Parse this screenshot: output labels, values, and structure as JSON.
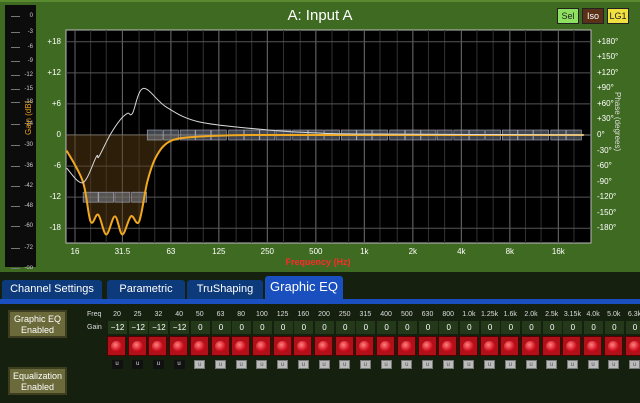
{
  "header": {
    "title": "A: Input A",
    "buttons": [
      {
        "label": "Sel",
        "color": "#8ee060"
      },
      {
        "label": "Iso",
        "color": "#5a3018"
      },
      {
        "label": "LG1",
        "color": "#f0e040"
      }
    ]
  },
  "meter": {
    "ticks": [
      "0",
      "-3",
      "-6",
      "-9",
      "-12",
      "-15",
      "-18",
      "-24",
      "-30",
      "-36",
      "-42",
      "-48",
      "-60",
      "-72",
      "-oo"
    ]
  },
  "chart_data": {
    "type": "line",
    "xlabel": "Frequency (Hz)",
    "ylabel": "Gain (dB)",
    "y2label": "Phase (degrees)",
    "xscale": "log",
    "xlim": [
      14,
      23000
    ],
    "ylim": [
      -20,
      20
    ],
    "y2lim": [
      -200,
      200
    ],
    "xticks": [
      "16",
      "31.5",
      "63",
      "125",
      "250",
      "500",
      "1k",
      "2k",
      "4k",
      "8k",
      "16k"
    ],
    "xtick_values": [
      16,
      31.5,
      63,
      125,
      250,
      500,
      1000,
      2000,
      4000,
      8000,
      16000
    ],
    "yticks": [
      "+18",
      "+12",
      "+6",
      "0",
      "-6",
      "-12",
      "-18"
    ],
    "ytick_values": [
      18,
      12,
      6,
      0,
      -6,
      -12,
      -18
    ],
    "y2ticks": [
      "+180°",
      "+150°",
      "+120°",
      "+90°",
      "+60°",
      "+30°",
      "0°",
      "-30°",
      "-60°",
      "-90°",
      "-120°",
      "-150°",
      "-180°"
    ],
    "y2tick_values": [
      180,
      150,
      120,
      90,
      60,
      30,
      0,
      -30,
      -60,
      -90,
      -120,
      -150,
      -180
    ],
    "series": [
      {
        "name": "Gain",
        "color": "#f0a820",
        "x": [
          14.2,
          17.9,
          20,
          22.3,
          25,
          28.3,
          31.5,
          35.6,
          40,
          45,
          51,
          61.5,
          86,
          195,
          1000,
          23000
        ],
        "y": [
          -3,
          -9,
          -16.7,
          -15.4,
          -19.2,
          -15.7,
          -19.2,
          -15.7,
          -16.7,
          -9,
          -4.2,
          -1.3,
          -0.4,
          0,
          0,
          0
        ]
      },
      {
        "name": "Phase",
        "color": "#d8d8d8",
        "axis": "y2",
        "x": [
          14.2,
          17.9,
          21.7,
          22.5,
          26.4,
          30.5,
          34,
          36.4,
          42.5,
          59,
          95,
          248,
          505,
          1000,
          23000
        ],
        "y": [
          -64,
          -92,
          -42,
          -42,
          0,
          29,
          42,
          42,
          90,
          54,
          25,
          10,
          4,
          2,
          0
        ]
      }
    ],
    "band_markers": {
      "freqs": [
        20,
        25,
        31.5,
        40,
        50,
        63,
        80,
        100,
        125,
        160,
        200,
        250,
        315,
        400,
        500,
        630,
        800,
        1000,
        1250,
        1600,
        2000,
        2500,
        3150,
        4000,
        5000,
        6300,
        8000,
        10000,
        12500,
        16000,
        20000
      ],
      "gains": [
        -12,
        -12,
        -12,
        -12,
        0,
        0,
        0,
        0,
        0,
        0,
        0,
        0,
        0,
        0,
        0,
        0,
        0,
        0,
        0,
        0,
        0,
        0,
        0,
        0,
        0,
        0,
        0,
        0,
        0,
        0,
        0
      ]
    }
  },
  "tabs": [
    {
      "label": "Channel Settings"
    },
    {
      "label": "Parametric"
    },
    {
      "label": "TruShaping"
    },
    {
      "label": "Graphic EQ",
      "active": true
    }
  ],
  "eq": {
    "graphic_eq_button": "Graphic EQ Enabled",
    "equalization_button": "Equalization Enabled",
    "freq_label": "Freq",
    "gain_label": "Gain",
    "bands": [
      {
        "f": "20",
        "g": "−12",
        "u": "u",
        "uActive": true
      },
      {
        "f": "25",
        "g": "−12",
        "u": "u",
        "uActive": true
      },
      {
        "f": "32",
        "g": "−12",
        "u": "u",
        "uActive": true
      },
      {
        "f": "40",
        "g": "−12",
        "u": "u",
        "uActive": true
      },
      {
        "f": "50",
        "g": "0",
        "u": "u"
      },
      {
        "f": "63",
        "g": "0",
        "u": "u"
      },
      {
        "f": "80",
        "g": "0",
        "u": "u"
      },
      {
        "f": "100",
        "g": "0",
        "u": "u"
      },
      {
        "f": "125",
        "g": "0",
        "u": "u"
      },
      {
        "f": "160",
        "g": "0",
        "u": "u"
      },
      {
        "f": "200",
        "g": "0",
        "u": "u"
      },
      {
        "f": "250",
        "g": "0",
        "u": "u"
      },
      {
        "f": "315",
        "g": "0",
        "u": "u"
      },
      {
        "f": "400",
        "g": "0",
        "u": "u"
      },
      {
        "f": "500",
        "g": "0",
        "u": "u"
      },
      {
        "f": "630",
        "g": "0",
        "u": "u"
      },
      {
        "f": "800",
        "g": "0",
        "u": "u"
      },
      {
        "f": "1.0k",
        "g": "0",
        "u": "u"
      },
      {
        "f": "1.25k",
        "g": "0",
        "u": "u"
      },
      {
        "f": "1.6k",
        "g": "0",
        "u": "u"
      },
      {
        "f": "2.0k",
        "g": "0",
        "u": "u"
      },
      {
        "f": "2.5k",
        "g": "0",
        "u": "u"
      },
      {
        "f": "3.15k",
        "g": "0",
        "u": "u"
      },
      {
        "f": "4.0k",
        "g": "0",
        "u": "u"
      },
      {
        "f": "5.0k",
        "g": "0",
        "u": "u"
      },
      {
        "f": "6.3k",
        "g": "0",
        "u": "u"
      }
    ]
  }
}
